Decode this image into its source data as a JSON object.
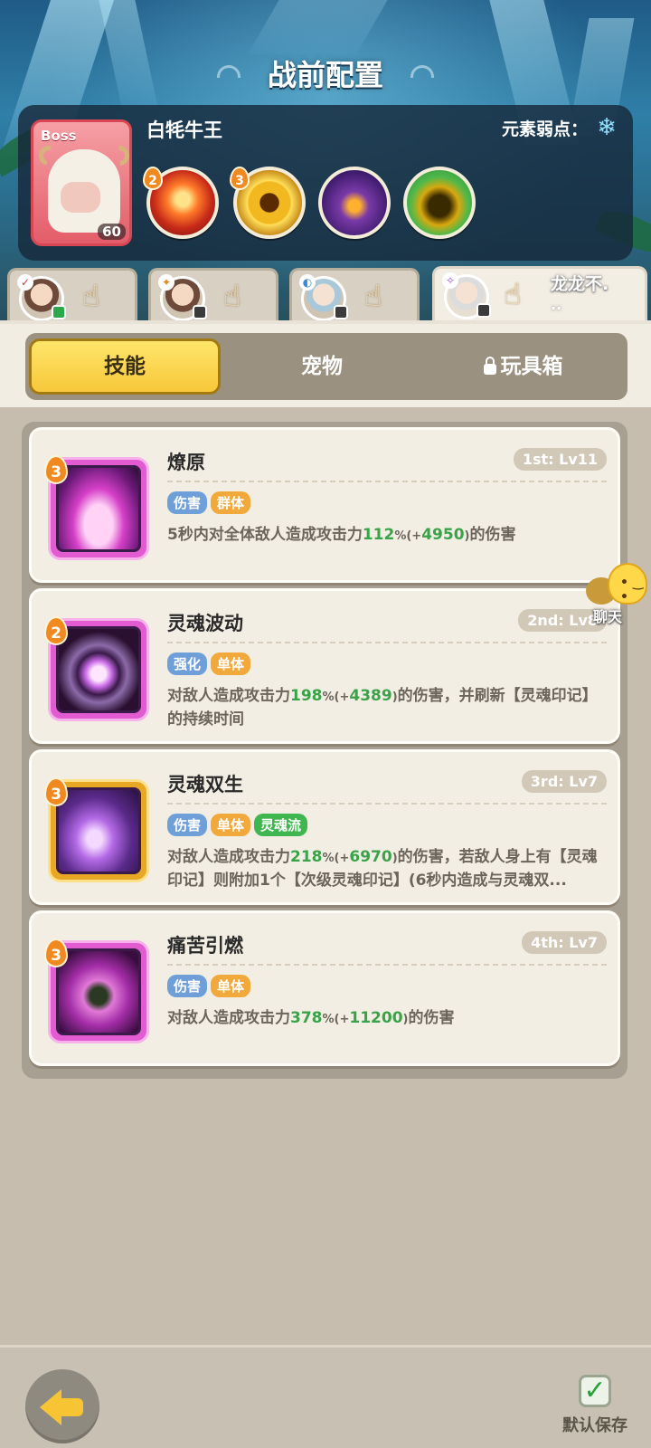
{
  "header": {
    "title": "战前配置"
  },
  "boss": {
    "tag": "Boss",
    "name": "白牦牛王",
    "level": "60",
    "weakness_label": "元素弱点：",
    "weakness_icon": "snowflake-icon",
    "skills": [
      {
        "icon": "fire-burst-icon",
        "badge": "2"
      },
      {
        "icon": "golden-vortex-icon",
        "badge": "3"
      },
      {
        "icon": "purple-beast-icon",
        "badge": ""
      },
      {
        "icon": "green-shadow-icon",
        "badge": ""
      }
    ]
  },
  "team": [
    {
      "name": ""
    },
    {
      "name": ""
    },
    {
      "name": ""
    },
    {
      "name": "龙龙不.",
      "name2": ".."
    }
  ],
  "tabs": {
    "skills": "技能",
    "pets": "宠物",
    "toybox": "玩具箱"
  },
  "skills": [
    {
      "badge": "3",
      "name": "燎原",
      "level": "1st: Lv11",
      "tags": [
        "伤害",
        "群体"
      ],
      "desc_pre": "5秒内对全体敌人造成攻击力",
      "pct_value": "112",
      "pct_sym": "%",
      "bonus_pre": "(+",
      "bonus_value": "4950",
      "bonus_post": ")",
      "desc_post": "的伤害"
    },
    {
      "badge": "2",
      "name": "灵魂波动",
      "level": "2nd: Lv8",
      "tags": [
        "强化",
        "单体"
      ],
      "desc_pre": "对敌人造成攻击力",
      "pct_value": "198",
      "pct_sym": "%",
      "bonus_pre": "(+",
      "bonus_value": "4389",
      "bonus_post": ")",
      "desc_post": "的伤害，并刷新【灵魂印记】的持续时间"
    },
    {
      "badge": "3",
      "name": "灵魂双生",
      "level": "3rd: Lv7",
      "tags": [
        "伤害",
        "单体",
        "灵魂流"
      ],
      "desc_pre": "对敌人造成攻击力",
      "pct_value": "218",
      "pct_sym": "%",
      "bonus_pre": "(+",
      "bonus_value": "6970",
      "bonus_post": ")",
      "desc_post": "的伤害，若敌人身上有【灵魂印记】则附加1个【次级灵魂印记】(6秒内造成与灵魂双..."
    },
    {
      "badge": "3",
      "name": "痛苦引燃",
      "level": "4th: Lv7",
      "tags": [
        "伤害",
        "单体"
      ],
      "desc_pre": "对敌人造成攻击力",
      "pct_value": "378",
      "pct_sym": "%",
      "bonus_pre": "(+",
      "bonus_value": "11200",
      "bonus_post": ")",
      "desc_post": "的伤害"
    }
  ],
  "chat": {
    "label": "聊天"
  },
  "footer": {
    "save_label": "默认保存"
  },
  "colors": {
    "accent_yellow": "#f7c83a",
    "highlight_green": "#3aa34a",
    "tag_blue": "#6f9fd8",
    "tag_orange": "#f0a93a",
    "tag_green": "#3fb64f"
  }
}
